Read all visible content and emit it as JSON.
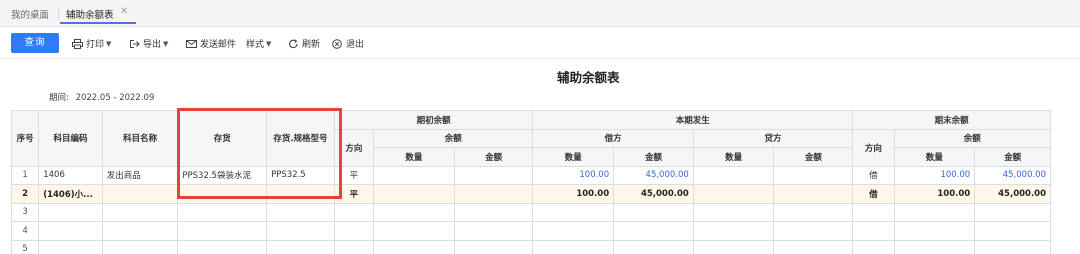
{
  "tabs": {
    "home": "我的桌面",
    "active": "辅助余额表",
    "close": "✕"
  },
  "toolbar": {
    "query": "查询",
    "print": "打印",
    "export": "导出",
    "send_email": "发送邮件",
    "style": "样式",
    "refresh": "刷新",
    "exit": "退出"
  },
  "report": {
    "title": "辅助余额表",
    "period_label": "期间:",
    "period_value": "2022.05 - 2022.09"
  },
  "table": {
    "headers": {
      "seq": "序号",
      "account_code": "科目编码",
      "account_name": "科目名称",
      "inventory": "存货",
      "spec": "存货.规格型号",
      "opening": "期初余额",
      "current": "本期发生",
      "closing": "期末余额",
      "direction": "方向",
      "balance": "余额",
      "debit": "借方",
      "credit": "贷方",
      "qty": "数量",
      "amount": "金额"
    },
    "rows": [
      {
        "seq": "1",
        "code": "1406",
        "name": "发出商品",
        "inventory": "PPS32.5袋装水泥",
        "spec": "PPS32.5",
        "open_dir": "平",
        "open_qty": "",
        "open_amt": "",
        "debit_qty": "100.00",
        "debit_amt": "45,000.00",
        "credit_qty": "",
        "credit_amt": "",
        "close_dir": "借",
        "close_qty": "100.00",
        "close_amt": "45,000.00"
      },
      {
        "seq": "2",
        "code": "(1406)小...",
        "name": "",
        "inventory": "",
        "spec": "",
        "open_dir": "平",
        "open_qty": "",
        "open_amt": "",
        "debit_qty": "100.00",
        "debit_amt": "45,000.00",
        "credit_qty": "",
        "credit_amt": "",
        "close_dir": "借",
        "close_qty": "100.00",
        "close_amt": "45,000.00"
      },
      {
        "seq": "3"
      },
      {
        "seq": "4"
      },
      {
        "seq": "5"
      }
    ]
  },
  "colors": {
    "primary": "#2f7bf5",
    "highlight_box": "#e8413d",
    "subtotal_bg": "#fff8e8",
    "blue_value": "#3a63d6"
  }
}
